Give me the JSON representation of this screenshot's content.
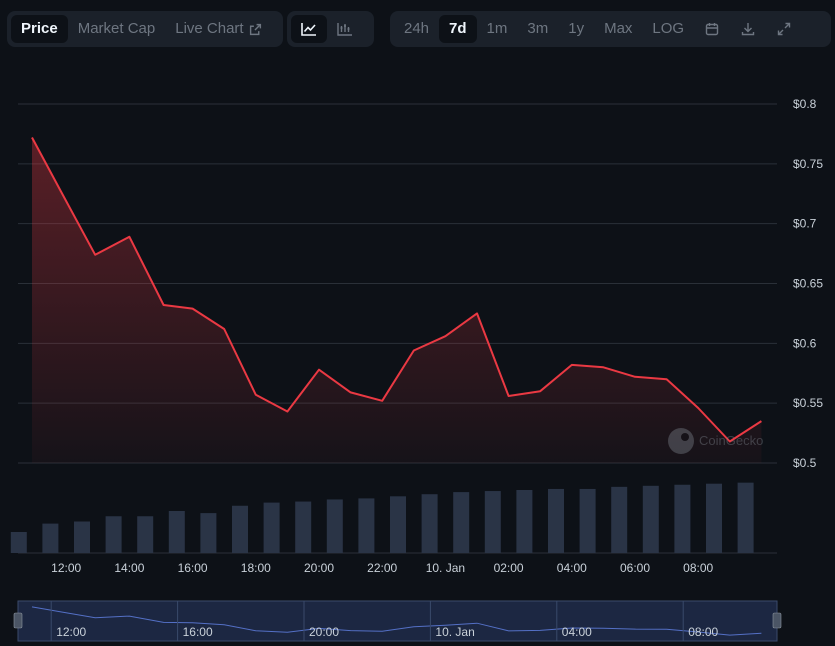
{
  "toolbar": {
    "view_tabs": [
      {
        "label": "Price",
        "active": true
      },
      {
        "label": "Market Cap",
        "active": false
      },
      {
        "label": "Live Chart",
        "active": false
      }
    ],
    "chart_type_icons": [
      "line-chart-icon",
      "bar-chart-icon"
    ],
    "ranges": [
      {
        "label": "24h",
        "active": false
      },
      {
        "label": "7d",
        "active": true
      },
      {
        "label": "1m",
        "active": false
      },
      {
        "label": "3m",
        "active": false
      },
      {
        "label": "1y",
        "active": false
      },
      {
        "label": "Max",
        "active": false
      },
      {
        "label": "LOG",
        "active": false
      }
    ],
    "tool_icons": [
      "calendar-icon",
      "download-icon",
      "expand-icon"
    ]
  },
  "watermark": "CoinGecko",
  "colors": {
    "line": "#ea3943",
    "volume_bar": "#2a3446",
    "grid": "#2a3038",
    "axis_text": "#c9d1d9",
    "navigator": "#5470c6"
  },
  "chart_data": {
    "type": "line",
    "y_tick_labels": [
      "$0.5",
      "$0.55",
      "$0.6",
      "$0.65",
      "$0.7",
      "$0.75",
      "$0.8"
    ],
    "ylim": [
      0.5,
      0.8
    ],
    "x_tick_labels": [
      "12:00",
      "14:00",
      "16:00",
      "18:00",
      "20:00",
      "22:00",
      "10. Jan",
      "02:00",
      "04:00",
      "06:00",
      "08:00"
    ],
    "price_series": [
      {
        "t": "9 Jan 10:55",
        "v": 0.772
      },
      {
        "t": "9 Jan 11:50",
        "v": 0.727
      },
      {
        "t": "9 Jan 12:55",
        "v": 0.674
      },
      {
        "t": "9 Jan 14:00",
        "v": 0.689
      },
      {
        "t": "9 Jan 15:05",
        "v": 0.632
      },
      {
        "t": "9 Jan 16:00",
        "v": 0.629
      },
      {
        "t": "9 Jan 17:00",
        "v": 0.612
      },
      {
        "t": "9 Jan 18:00",
        "v": 0.557
      },
      {
        "t": "9 Jan 19:00",
        "v": 0.543
      },
      {
        "t": "9 Jan 20:00",
        "v": 0.578
      },
      {
        "t": "9 Jan 21:00",
        "v": 0.559
      },
      {
        "t": "9 Jan 22:00",
        "v": 0.552
      },
      {
        "t": "9 Jan 23:00",
        "v": 0.594
      },
      {
        "t": "10 Jan 00:00",
        "v": 0.606
      },
      {
        "t": "10 Jan 01:00",
        "v": 0.625
      },
      {
        "t": "10 Jan 02:00",
        "v": 0.556
      },
      {
        "t": "10 Jan 03:00",
        "v": 0.56
      },
      {
        "t": "10 Jan 04:00",
        "v": 0.582
      },
      {
        "t": "10 Jan 05:00",
        "v": 0.58
      },
      {
        "t": "10 Jan 06:00",
        "v": 0.572
      },
      {
        "t": "10 Jan 07:00",
        "v": 0.57
      },
      {
        "t": "10 Jan 08:00",
        "v": 0.546
      },
      {
        "t": "10 Jan 09:00",
        "v": 0.518
      },
      {
        "t": "10 Jan 10:00",
        "v": 0.535
      }
    ],
    "volume_series": [
      {
        "t": "9 Jan 10:30",
        "v": 20
      },
      {
        "t": "9 Jan 11:30",
        "v": 28
      },
      {
        "t": "9 Jan 12:30",
        "v": 30
      },
      {
        "t": "9 Jan 13:30",
        "v": 35
      },
      {
        "t": "9 Jan 14:30",
        "v": 35
      },
      {
        "t": "9 Jan 15:30",
        "v": 40
      },
      {
        "t": "9 Jan 16:30",
        "v": 38
      },
      {
        "t": "9 Jan 17:30",
        "v": 45
      },
      {
        "t": "9 Jan 18:30",
        "v": 48
      },
      {
        "t": "9 Jan 19:30",
        "v": 49
      },
      {
        "t": "9 Jan 20:30",
        "v": 51
      },
      {
        "t": "9 Jan 21:30",
        "v": 52
      },
      {
        "t": "9 Jan 22:30",
        "v": 54
      },
      {
        "t": "9 Jan 23:30",
        "v": 56
      },
      {
        "t": "10 Jan 00:30",
        "v": 58
      },
      {
        "t": "10 Jan 01:30",
        "v": 59
      },
      {
        "t": "10 Jan 02:30",
        "v": 60
      },
      {
        "t": "10 Jan 03:30",
        "v": 61
      },
      {
        "t": "10 Jan 04:30",
        "v": 61
      },
      {
        "t": "10 Jan 05:30",
        "v": 63
      },
      {
        "t": "10 Jan 06:30",
        "v": 64
      },
      {
        "t": "10 Jan 07:30",
        "v": 65
      },
      {
        "t": "10 Jan 08:30",
        "v": 66
      },
      {
        "t": "10 Jan 09:30",
        "v": 67
      }
    ],
    "navigator_labels": [
      "12:00",
      "16:00",
      "20:00",
      "10. Jan",
      "04:00",
      "08:00"
    ],
    "grid": true,
    "legend": "none"
  }
}
